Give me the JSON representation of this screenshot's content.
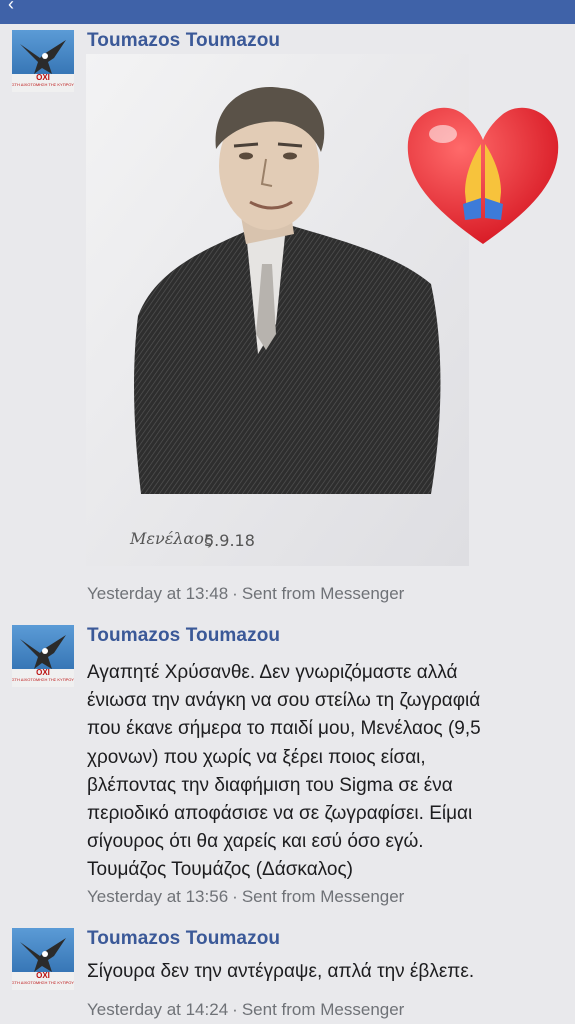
{
  "topbar": {
    "back_icon": "chevron-left-icon"
  },
  "messages": [
    {
      "author": "Toumazos Toumazou",
      "avatar_caption": "OXI",
      "avatar_sub": "ΣΤΗ ΔΙΧΟΤΟΜΗΣΗ ΤΗΣ ΚΥΠΡΟΥ",
      "timestamp": "Yesterday at 13:48",
      "source": "Sent from Messenger",
      "attachment": {
        "type": "image",
        "description_icon": "pencil-drawing-portrait",
        "signature": "Μενέλαος",
        "date": "5.9.18"
      },
      "reaction_sticker": "praying-hands-heart-icon"
    },
    {
      "author": "Toumazos Toumazou",
      "avatar_caption": "OXI",
      "avatar_sub": "ΣΤΗ ΔΙΧΟΤΟΜΗΣΗ ΤΗΣ ΚΥΠΡΟΥ",
      "text": "Αγαπητέ Χρύσανθε. Δεν γνωριζόμαστε αλλά\nένιωσα την ανάγκη να σου στείλω τη ζωγραφιά\nπου έκανε σήμερα το παιδί μου, Μενέλαος (9,5\nχρονων) που χωρίς να ξέρει ποιος είσαι,\nβλέποντας την διαφήμιση του Sigma σε ένα\nπεριοδικό αποφάσισε να σε ζωγραφίσει. Είμαι\nσίγουρος ότι θα χαρείς και εσύ όσο εγώ.\nΤουμάζος Τουμάζος (Δάσκαλος)",
      "timestamp": "Yesterday at 13:56",
      "source": "Sent from Messenger"
    },
    {
      "author": "Toumazos Toumazou",
      "avatar_caption": "OXI",
      "avatar_sub": "ΣΤΗ ΔΙΧΟΤΟΜΗΣΗ ΤΗΣ ΚΥΠΡΟΥ",
      "text": "Σίγουρα δεν την αντέγραψε, απλά την έβλεπε.",
      "timestamp": "Yesterday at 14:24",
      "source": "Sent from Messenger"
    }
  ],
  "separator": "·",
  "colors": {
    "topbar": "#3f62a8",
    "author": "#3b5998",
    "meta": "#6f7277",
    "background": "#e9e9ec"
  }
}
